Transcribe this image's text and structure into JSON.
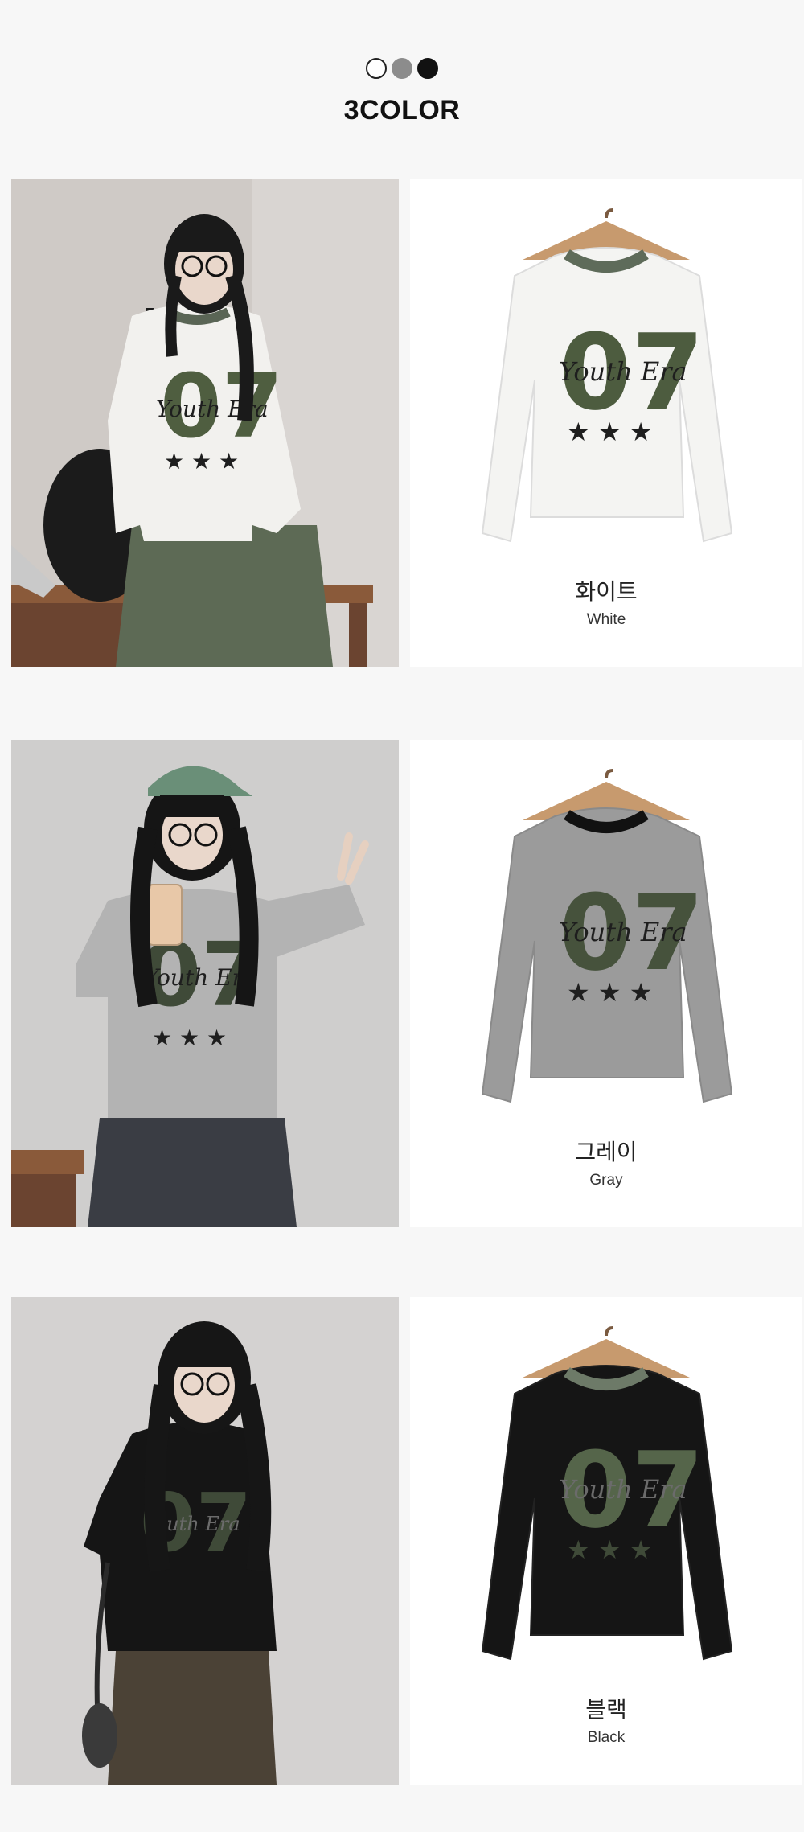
{
  "header": {
    "swatches": [
      {
        "name": "white-swatch",
        "color": "#ffffff"
      },
      {
        "name": "gray-swatch",
        "color": "#8c8c8c"
      },
      {
        "name": "black-swatch",
        "color": "#111111"
      }
    ],
    "title": "3COLOR"
  },
  "colors": [
    {
      "id": "white",
      "name_ko": "화이트",
      "name_en": "White",
      "shirt": "#f4f4f2",
      "trim": "#5e6b5a"
    },
    {
      "id": "gray",
      "name_ko": "그레이",
      "name_en": "Gray",
      "shirt": "#9b9b9b",
      "trim": "#111111"
    },
    {
      "id": "black",
      "name_ko": "블랙",
      "name_en": "Black",
      "shirt": "#151515",
      "trim": "#6d7a68"
    }
  ],
  "graphic": {
    "number": "07",
    "script": "Youth Era"
  }
}
